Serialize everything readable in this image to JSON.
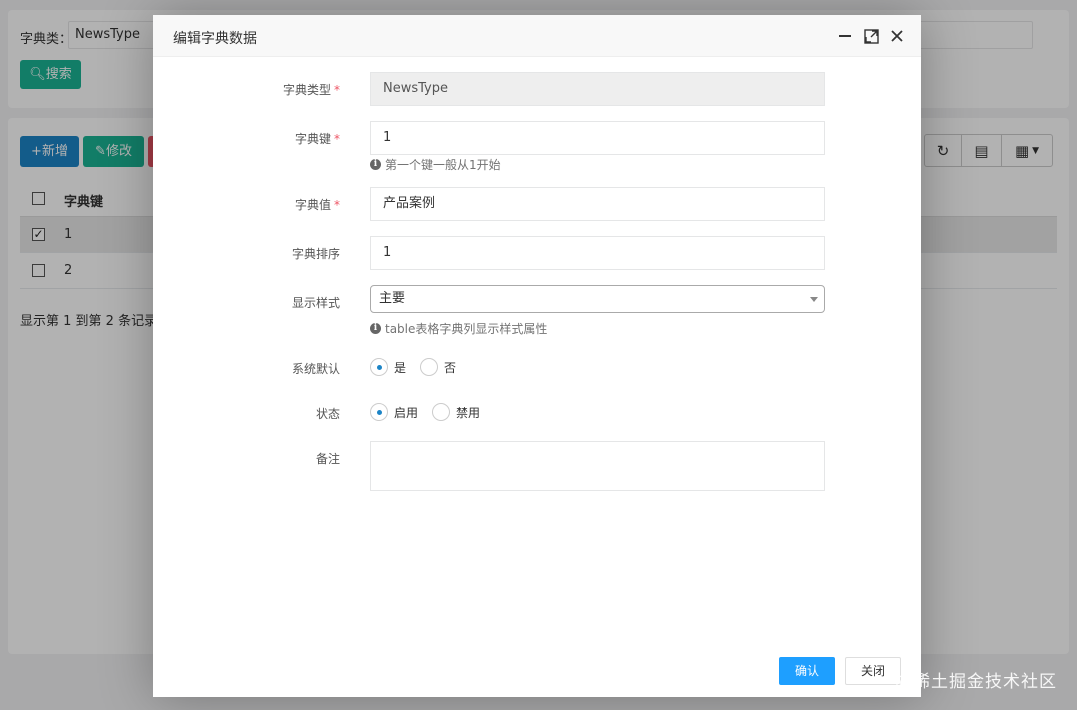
{
  "background": {
    "search": {
      "label": "字典类：",
      "value": "NewsType",
      "button": "搜索"
    },
    "toolbar": {
      "add": "新增",
      "edit": "修改"
    },
    "table": {
      "header": "字典键",
      "rows": [
        {
          "value": "1",
          "checked": true
        },
        {
          "value": "2",
          "checked": false
        }
      ]
    },
    "pager_text": "显示第 1 到第 2 条记录，"
  },
  "modal": {
    "title": "编辑字典数据",
    "fields": {
      "dict_type": {
        "label": "字典类型",
        "value": "NewsType",
        "required": true
      },
      "dict_key": {
        "label": "字典键",
        "value": "1",
        "required": true,
        "help": "第一个键一般从1开始"
      },
      "dict_value": {
        "label": "字典值",
        "value": "产品案例",
        "required": true
      },
      "dict_sort": {
        "label": "字典排序",
        "value": "1"
      },
      "display_style": {
        "label": "显示样式",
        "selected": "主要",
        "help": "table表格字典列显示样式属性"
      },
      "is_default": {
        "label": "系统默认",
        "options": [
          "是",
          "否"
        ],
        "selected": "是"
      },
      "status": {
        "label": "状态",
        "options": [
          "启用",
          "禁用"
        ],
        "selected": "启用"
      },
      "remark": {
        "label": "备注",
        "value": ""
      }
    },
    "buttons": {
      "confirm": "确认",
      "close": "关闭"
    }
  },
  "watermark": "@稀土掘金技术社区",
  "colors": {
    "primary": "#1e9fff",
    "success": "#1ab394",
    "info": "#1c84c6",
    "danger": "#ed5565",
    "required": "#ed5565"
  },
  "icons": [
    "search-icon",
    "plus-icon",
    "edit-icon",
    "refresh-icon",
    "list-icon",
    "columns-icon",
    "minimize-icon",
    "maximize-icon",
    "close-icon",
    "info-icon",
    "caret-down-icon"
  ]
}
